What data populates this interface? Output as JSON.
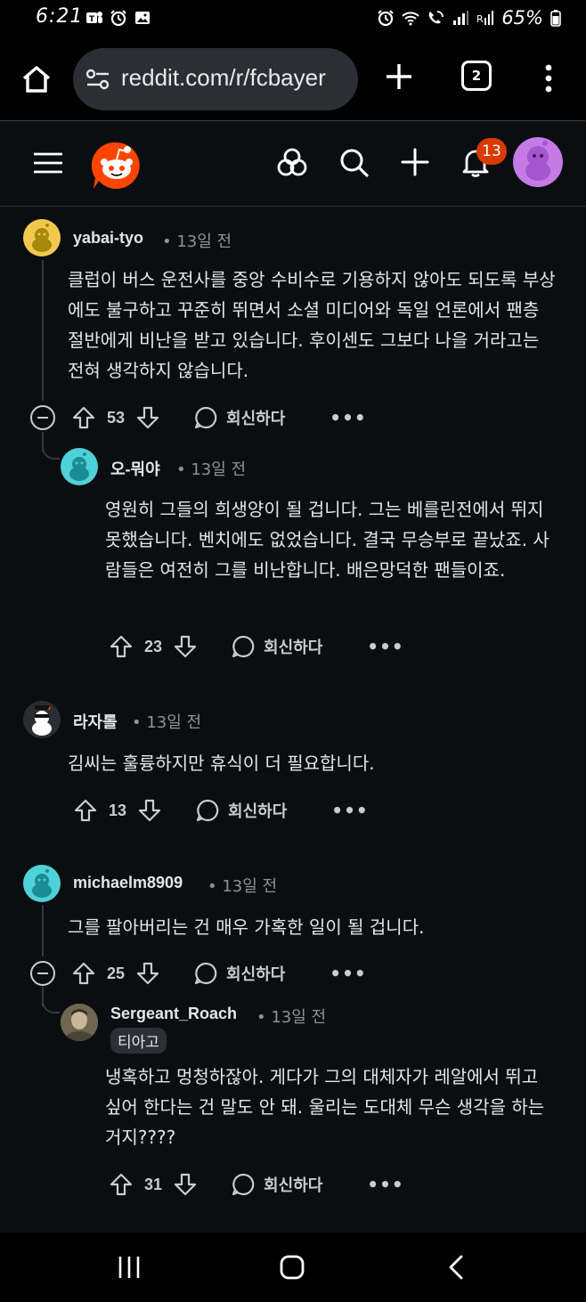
{
  "status_bar": {
    "time": "6:21",
    "battery": "65%"
  },
  "browser": {
    "url": "reddit.com/r/fcbayer",
    "tab_count": "2"
  },
  "header": {
    "notification_count": "13"
  },
  "comments": [
    {
      "username": "yabai-tyo",
      "time": "• 13일 전",
      "body": "클럽이 버스 운전사를 중앙 수비수로 기용하지 않아도 되도록 부상에도 불구하고 꾸준히 뛰면서 소셜 미디어와 독일 언론에서 팬층 절반에게 비난을 받고 있습니다. 후이센도 그보다 나을 거라고는 전혀 생각하지 않습니다.",
      "votes": "53",
      "reply_label": "회신하다",
      "more": "•••",
      "avatar_color": "#f2c94c"
    },
    {
      "username": "오-뭐야",
      "time": "• 13일 전",
      "body": "영원히 그들의 희생양이 될 겁니다. 그는 베를린전에서 뛰지 못했습니다. 벤치에도 없었습니다. 결국 무승부로 끝났죠. 사람들은 여전히 그를 비난합니다. 배은망덕한 팬들이죠.",
      "votes": "23",
      "reply_label": "회신하다",
      "more": "•••",
      "avatar_color": "#4fd1d9"
    },
    {
      "username": "라자롤",
      "time": "• 13일 전",
      "body": "김씨는 훌륭하지만 휴식이 더 필요합니다.",
      "votes": "13",
      "reply_label": "회신하다",
      "more": "•••",
      "avatar_color": "#2a2e33"
    },
    {
      "username": "michaelm8909",
      "time": "• 13일 전",
      "body": "그를 팔아버리는 건 매우 가혹한 일이 될 겁니다.",
      "votes": "25",
      "reply_label": "회신하다",
      "more": "•••",
      "avatar_color": "#4fd1d9"
    },
    {
      "username": "Sergeant_Roach",
      "time": "• 13일 전",
      "flair": "티아고",
      "body": "냉혹하고 멍청하잖아. 게다가 그의 대체자가 레알에서 뛰고 싶어 한다는 건 말도 안 돼. 울리는 도대체 무슨 생각을 하는 거지????",
      "votes": "31",
      "reply_label": "회신하다",
      "more": "•••",
      "avatar_color": "#8a7a5a"
    }
  ],
  "colors": {
    "background": "#0b0e11",
    "reddit_orange": "#ff4500",
    "badge": "#d93a00",
    "user_avatar": "#c67ae6"
  }
}
